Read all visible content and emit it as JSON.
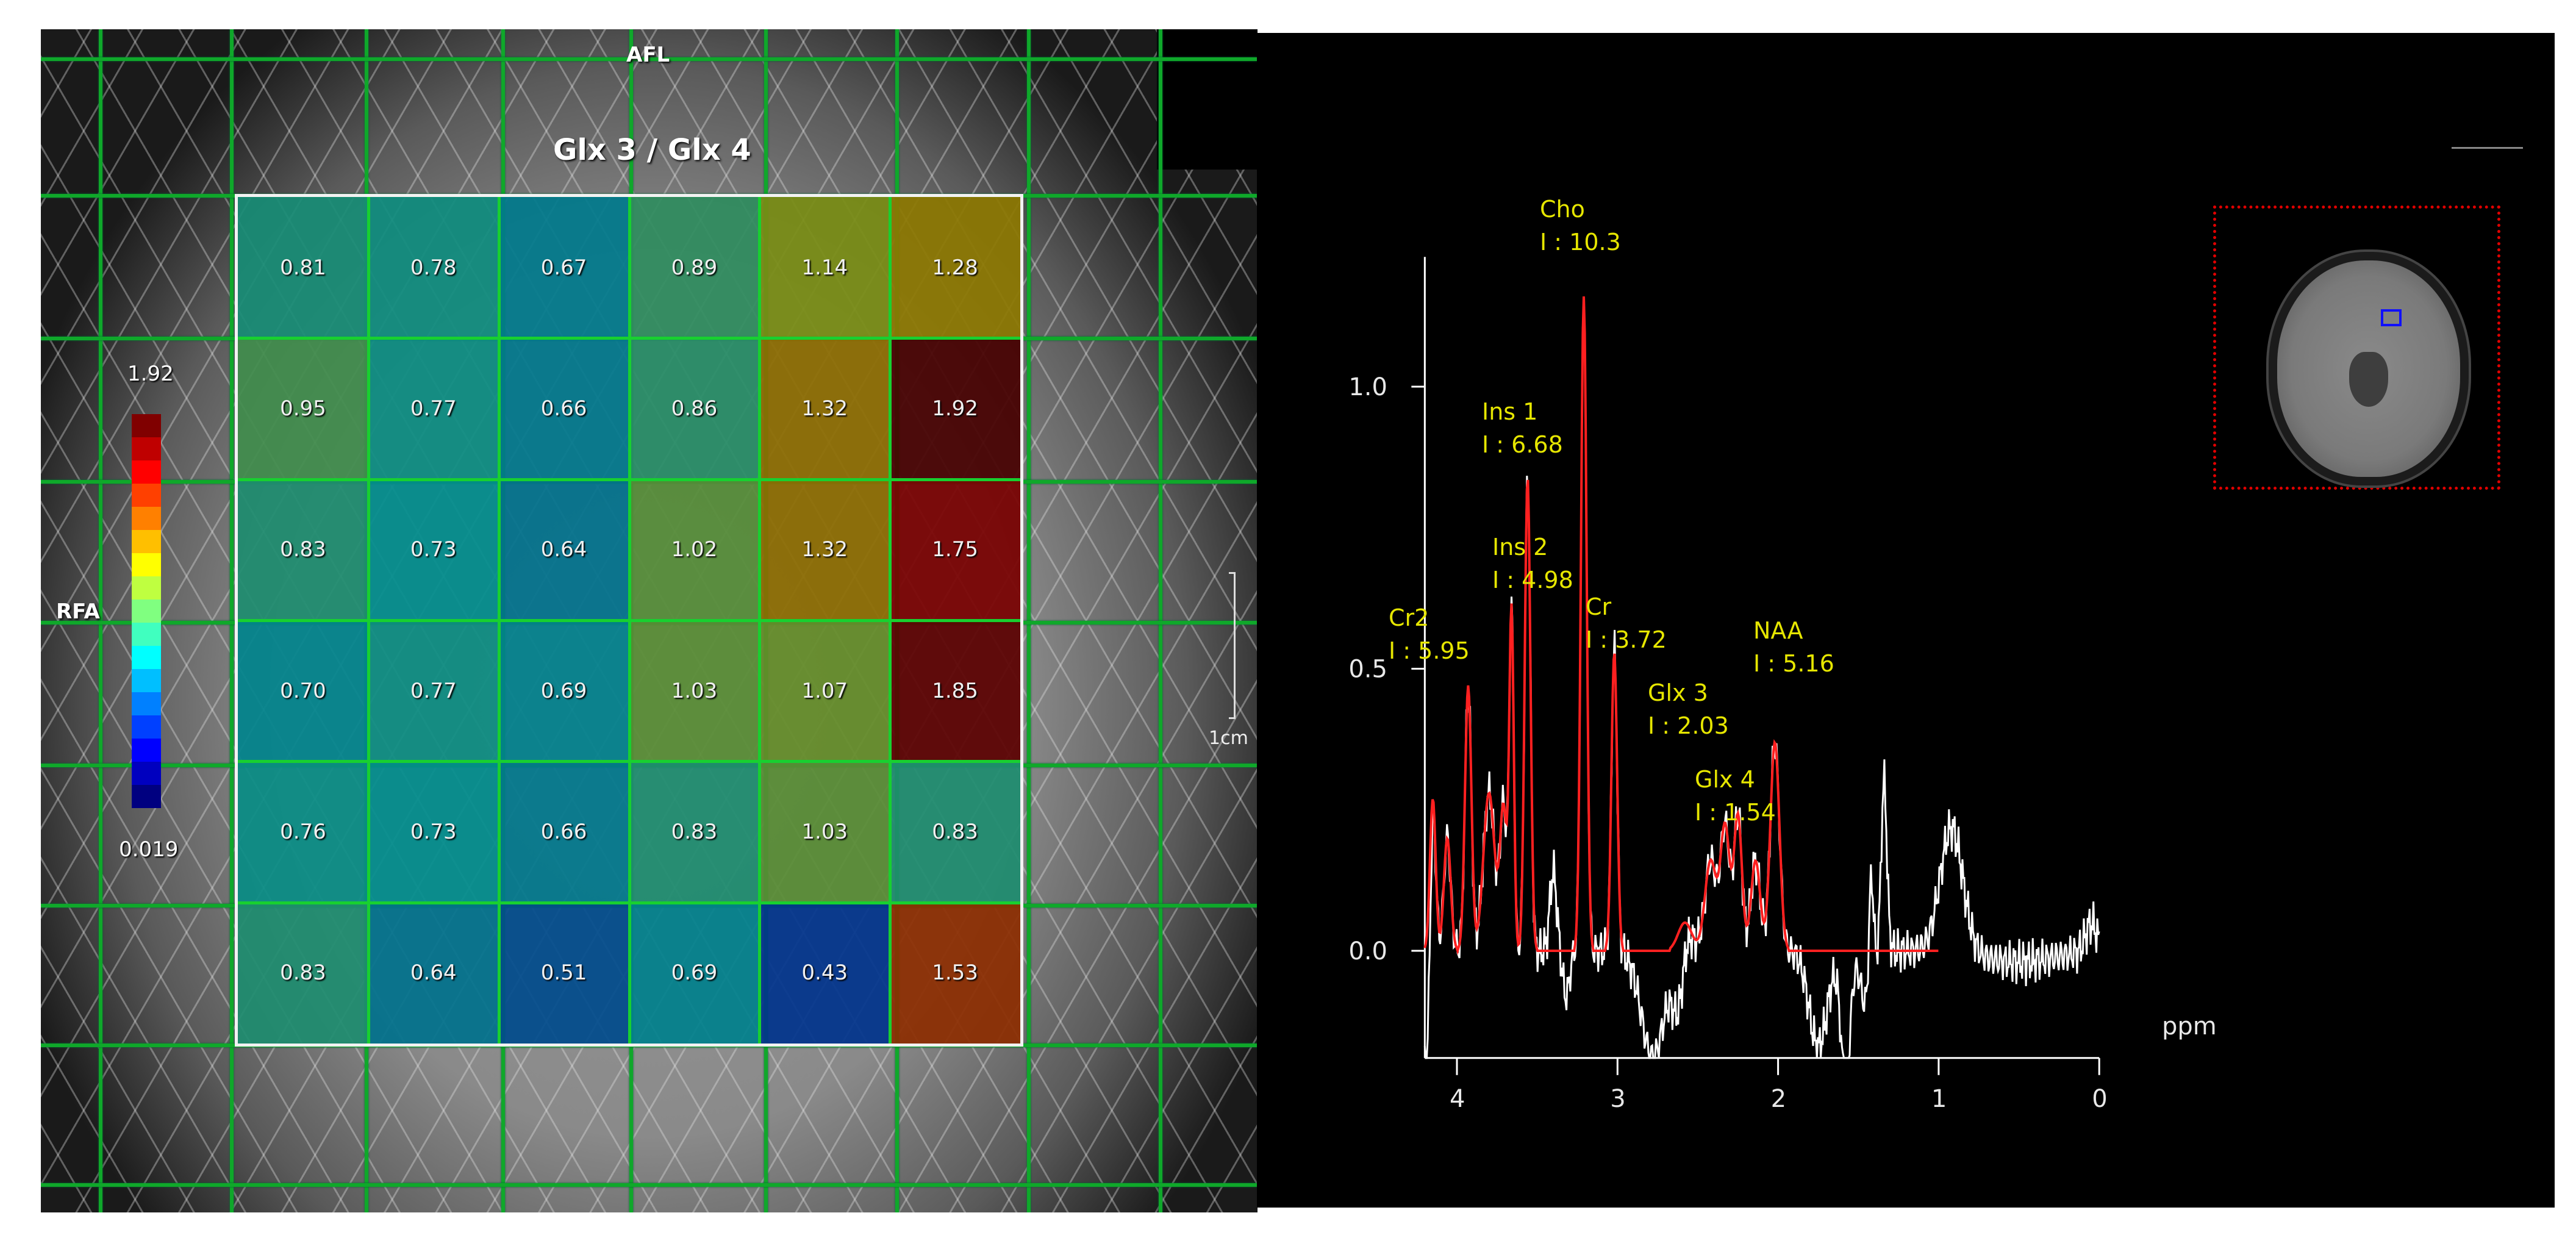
{
  "left_panel": {
    "title": "Glx 3 / Glx 4",
    "orientation_top": "AFL",
    "orientation_left": "RFA",
    "scale_label": "1cm",
    "colorbar": {
      "max_label": "1.92",
      "min_label": "0.019",
      "min": 0.019,
      "max": 1.92,
      "colormap": "jet"
    },
    "grid_values": [
      [
        "0.81",
        "0.78",
        "0.67",
        "0.89",
        "1.14",
        "1.28"
      ],
      [
        "0.95",
        "0.77",
        "0.66",
        "0.86",
        "1.32",
        "1.92"
      ],
      [
        "0.83",
        "0.73",
        "0.64",
        "1.02",
        "1.32",
        "1.75"
      ],
      [
        "0.70",
        "0.77",
        "0.69",
        "1.03",
        "1.07",
        "1.85"
      ],
      [
        "0.76",
        "0.73",
        "0.66",
        "0.83",
        "1.03",
        "0.83"
      ],
      [
        "0.83",
        "0.64",
        "0.51",
        "0.69",
        "0.43",
        "1.53"
      ]
    ]
  },
  "chart_data": {
    "type": "line",
    "title": "",
    "xlabel": "ppm",
    "ylabel": "",
    "xlim": [
      4.2,
      0.0
    ],
    "ylim": [
      -0.19,
      1.23
    ],
    "x_ticks": [
      {
        "value": 4,
        "label": "4"
      },
      {
        "value": 3,
        "label": "3"
      },
      {
        "value": 2,
        "label": "2"
      },
      {
        "value": 1,
        "label": "1"
      },
      {
        "value": 0,
        "label": "0"
      }
    ],
    "y_ticks": [
      {
        "value": 0.0,
        "label": "0.0"
      },
      {
        "value": 0.5,
        "label": "0.5"
      },
      {
        "value": 1.0,
        "label": "1.0"
      }
    ],
    "series": [
      {
        "name": "measured spectrum",
        "color": "#ffffff",
        "range_ppm": [
          4.2,
          0.0
        ]
      },
      {
        "name": "fitted spectrum",
        "color": "#ff2020",
        "range_ppm": [
          4.2,
          1.0
        ]
      }
    ],
    "fit_components": [
      [
        4.15,
        0.27,
        0.025
      ],
      [
        4.06,
        0.2,
        0.03
      ],
      [
        3.93,
        0.47,
        0.028
      ],
      [
        3.8,
        0.28,
        0.05
      ],
      [
        3.71,
        0.25,
        0.03
      ],
      [
        3.66,
        0.6,
        0.02
      ],
      [
        3.56,
        0.84,
        0.025
      ],
      [
        3.21,
        1.16,
        0.025
      ],
      [
        3.02,
        0.53,
        0.025
      ],
      [
        2.58,
        0.05,
        0.06
      ],
      [
        2.42,
        0.16,
        0.05
      ],
      [
        2.33,
        0.22,
        0.04
      ],
      [
        2.25,
        0.24,
        0.035
      ],
      [
        2.14,
        0.16,
        0.04
      ],
      [
        2.02,
        0.37,
        0.04
      ]
    ],
    "residual_components": [
      [
        4.19,
        -0.22,
        0.03
      ],
      [
        3.4,
        0.14,
        0.03
      ],
      [
        3.32,
        -0.08,
        0.03
      ],
      [
        2.78,
        -0.19,
        0.1
      ],
      [
        2.62,
        -0.12,
        0.05
      ],
      [
        1.75,
        -0.17,
        0.08
      ],
      [
        1.58,
        -0.24,
        0.04
      ],
      [
        1.45,
        -0.1,
        0.05
      ],
      [
        1.34,
        0.3,
        0.025
      ],
      [
        1.42,
        0.2,
        0.02
      ],
      [
        0.92,
        0.22,
        0.1
      ],
      [
        0.5,
        -0.02,
        0.3
      ],
      [
        0.05,
        0.05,
        0.05
      ]
    ],
    "peak_labels": [
      {
        "name": "Cho",
        "intensity": "I : 10.3"
      },
      {
        "name": "Ins 1",
        "intensity": "I : 6.68"
      },
      {
        "name": "Ins 2",
        "intensity": "I : 4.98"
      },
      {
        "name": "Cr2",
        "intensity": "I : 5.95"
      },
      {
        "name": "Cr",
        "intensity": "I : 3.72"
      },
      {
        "name": "NAA",
        "intensity": "I : 5.16"
      },
      {
        "name": "Glx 3",
        "intensity": "I : 2.03"
      },
      {
        "name": "Glx 4",
        "intensity": "I : 1.54"
      }
    ]
  },
  "colors": {
    "fit": "#ff2020",
    "measured": "#ffffff",
    "peak_label": "#e6e600",
    "roi_box": "#e00000",
    "voxel": "#1010ff"
  }
}
